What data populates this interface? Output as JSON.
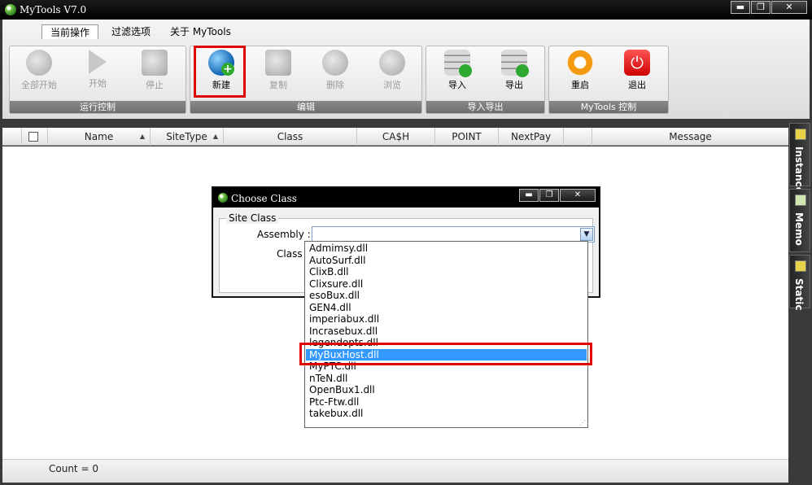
{
  "window": {
    "title": "MyTools V7.0"
  },
  "window_buttons": {
    "minimize": "▬",
    "maximize": "❐",
    "close": "✕"
  },
  "tabs": [
    "当前操作",
    "过滤选项",
    "关于 MyTools"
  ],
  "ribbon_groups": [
    {
      "label": "运行控制",
      "buttons": [
        "全部开始",
        "开始",
        "停止"
      ]
    },
    {
      "label": "编辑",
      "buttons": [
        "新建",
        "复制",
        "删除",
        "浏览"
      ]
    },
    {
      "label": "导入导出",
      "buttons": [
        "导入",
        "导出"
      ]
    },
    {
      "label": "MyTools 控制",
      "buttons": [
        "重启",
        "退出"
      ]
    }
  ],
  "grid": {
    "columns": [
      "Name",
      "SiteType",
      "Class",
      "CA$H",
      "POINT",
      "NextPay",
      "",
      "Message"
    ]
  },
  "status": {
    "count": "Count = 0"
  },
  "side_tabs": [
    "Instance",
    "Memo",
    "Static"
  ],
  "dialog": {
    "title": "Choose Class",
    "group_label": "Site Class",
    "assembly_label": "Assembly :",
    "class_label": "Class :",
    "assembly_value": "",
    "dropdown_items": [
      "Admimsy.dll",
      "AutoSurf.dll",
      "ClixB.dll",
      "Clixsure.dll",
      "esoBux.dll",
      "GEN4.dll",
      "imperiabux.dll",
      "Incrasebux.dll",
      "legendopts.dll",
      "MyBuxHost.dll",
      "MyPTC.dll",
      "nTeN.dll",
      "OpenBux1.dll",
      "Ptc-Ftw.dll",
      "takebux.dll"
    ],
    "selected_item": "MyBuxHost.dll"
  },
  "colors": {
    "highlight": "#e00000",
    "selection": "#3399ff"
  }
}
